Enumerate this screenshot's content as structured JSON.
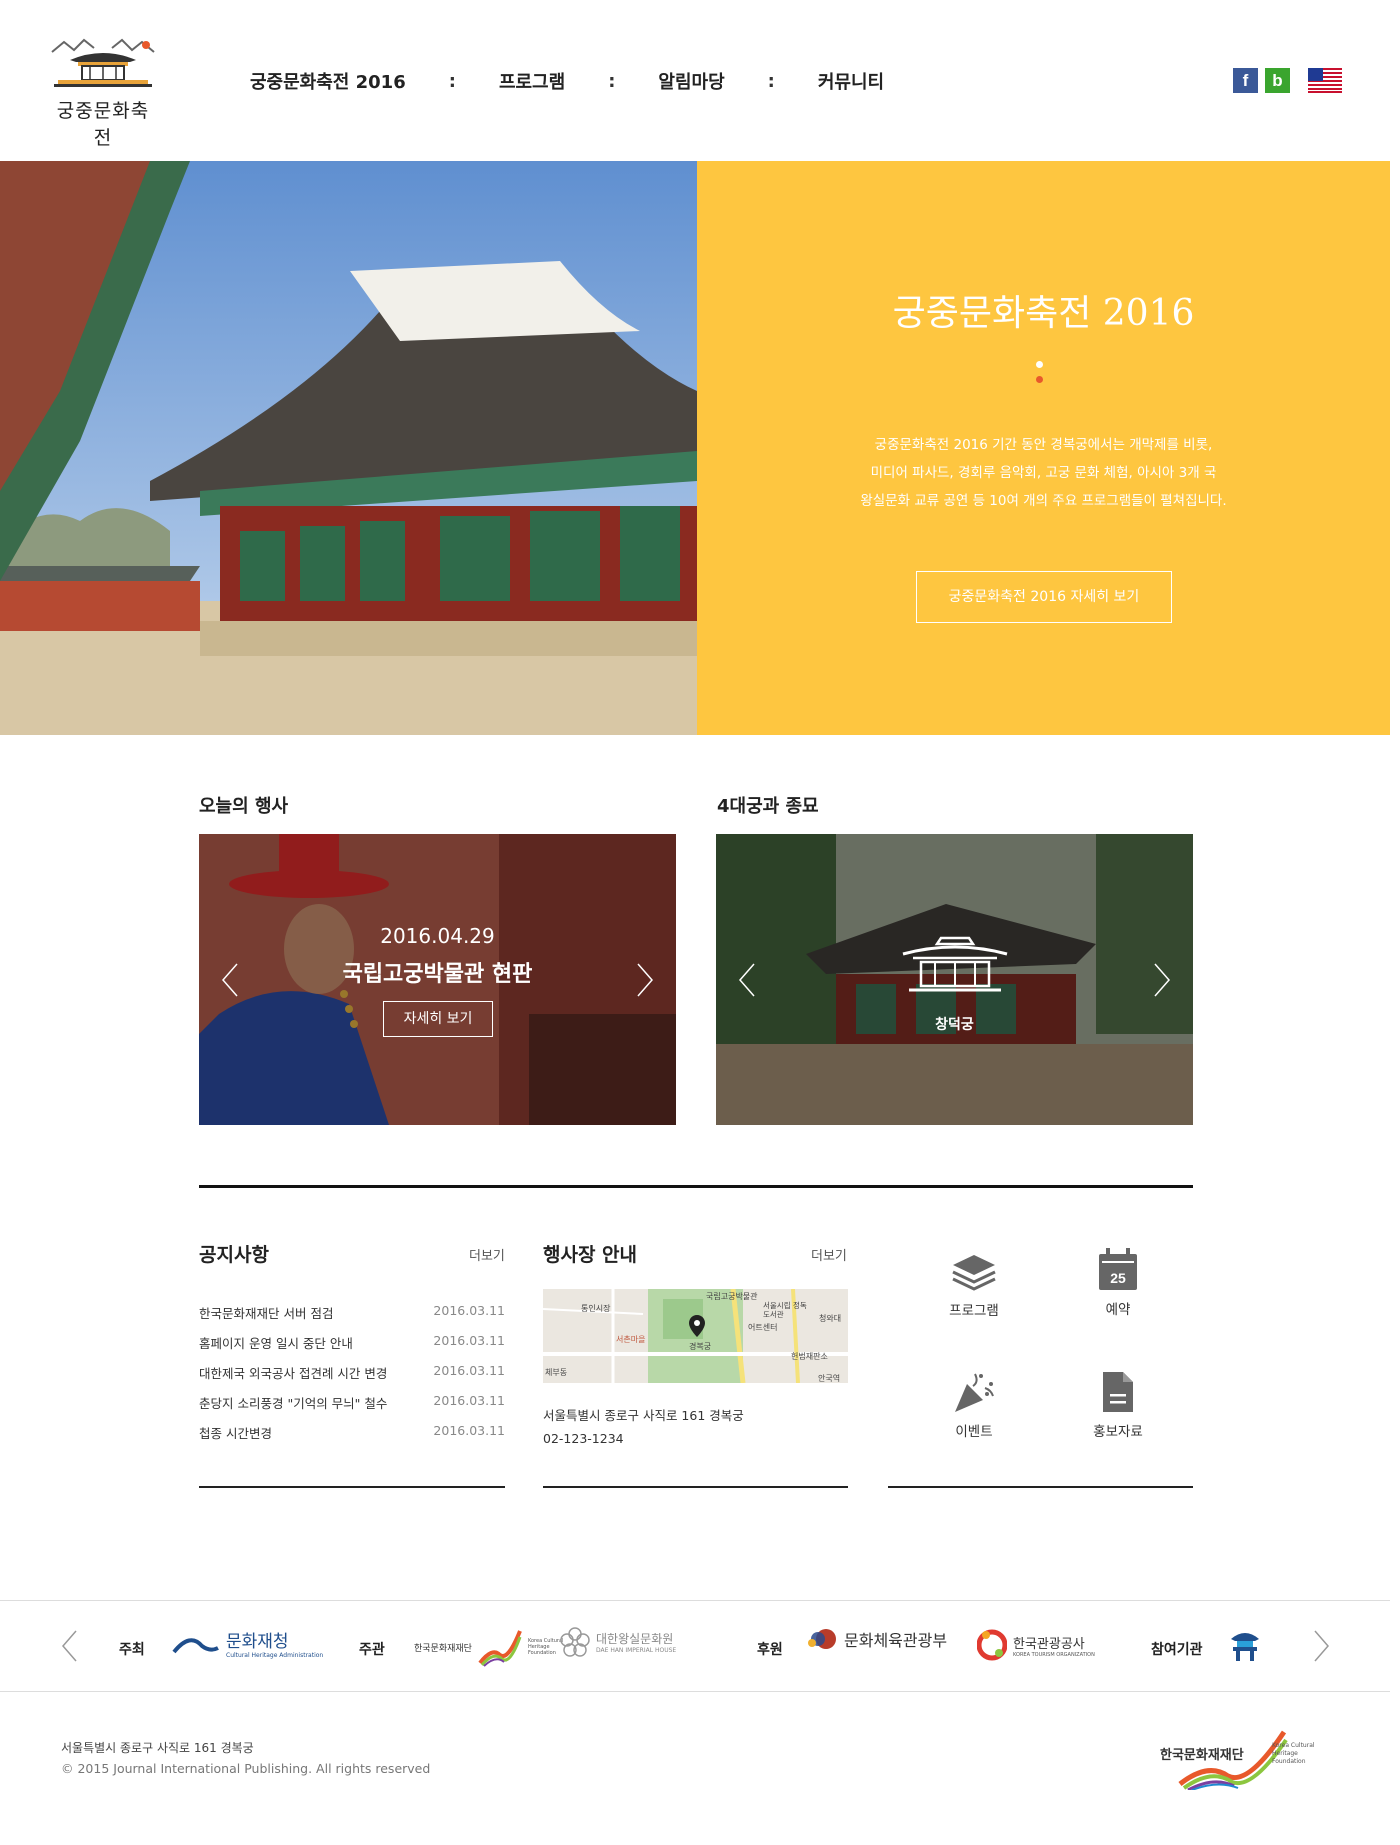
{
  "header": {
    "logo_text": "궁중문화축전",
    "nav": [
      "궁중문화축전 2016",
      "프로그램",
      "알림마당",
      "커뮤니티"
    ],
    "separator": ":",
    "social": {
      "facebook": "f",
      "blog": "b"
    }
  },
  "hero": {
    "title": "궁중문화축전 2016",
    "desc_lines": [
      "궁중문화축전 2016 기간 동안 경복궁에서는 개막제를 비롯,",
      "미디어 파사드, 경회루 음악회, 고궁 문화 체험, 아시아 3개 국",
      "왕실문화 교류 공연 등 10여 개의 주요 프로그램들이 펼쳐집니다."
    ],
    "button": "궁중문화축전 2016 자세히 보기",
    "dot_colors": [
      "#ffffff",
      "#e8592b"
    ],
    "panel_color": "#fec640"
  },
  "today": {
    "title": "오늘의 행사",
    "date": "2016.04.29",
    "event": "국립고궁박물관 현판",
    "button": "자세히 보기"
  },
  "palaces": {
    "title": "4대궁과 종묘",
    "label": "창덕궁"
  },
  "notice": {
    "title": "공지사항",
    "more": "더보기",
    "items": [
      {
        "text": "한국문화재재단 서버 점검",
        "date": "2016.03.11"
      },
      {
        "text": "홈페이지 운영 일시 중단 안내",
        "date": "2016.03.11"
      },
      {
        "text": "대한제국 외국공사 접견례 시간 변경",
        "date": "2016.03.11"
      },
      {
        "text": "춘당지 소리풍경 \"기억의 무늬\" 철수",
        "date": "2016.03.11"
      },
      {
        "text": "첩종 시간변경",
        "date": "2016.03.11"
      }
    ]
  },
  "venue": {
    "title": "행사장 안내",
    "more": "더보기",
    "address": "서울특별시 종로구 사직로 161 경복궁",
    "phone": "02-123-1234",
    "map_labels": [
      "통인시장",
      "국립고궁박물관",
      "서울시립 정독도서관",
      "청와대",
      "어트센터",
      "서촌마을",
      "경복궁",
      "헌법재판소",
      "체부동",
      "안국역"
    ]
  },
  "quicklinks": [
    {
      "label": "프로그램",
      "icon": "layers-icon"
    },
    {
      "label": "예약",
      "icon": "calendar-icon",
      "day": "25"
    },
    {
      "label": "이벤트",
      "icon": "party-popper-icon"
    },
    {
      "label": "홍보자료",
      "icon": "document-icon"
    }
  ],
  "partners": {
    "host_label": "주최",
    "host": "문화재청",
    "host_sub": "Cultural Heritage Administration",
    "organizer_label": "주관",
    "organizer1": "한국문화재재단",
    "organizer1_en": "Korea Cultural Heritage Foundation",
    "organizer2": "대한왕실문화원",
    "organizer2_en": "DAE HAN IMPERIAL HOUSE",
    "sponsor_label": "후원",
    "sponsor1": "문화체육관광부",
    "sponsor2": "한국관광공사",
    "sponsor2_en": "KOREA TOURISM ORGANIZATION",
    "participant_label": "참여기관"
  },
  "footer": {
    "address": "서울특별시 종로구 사직로 161 경복궁",
    "copyright": "© 2015 Journal International Publishing. All rights reserved",
    "logo_name": "한국문화재재단",
    "logo_en": "Korea Cultural Heritage Foundation"
  }
}
